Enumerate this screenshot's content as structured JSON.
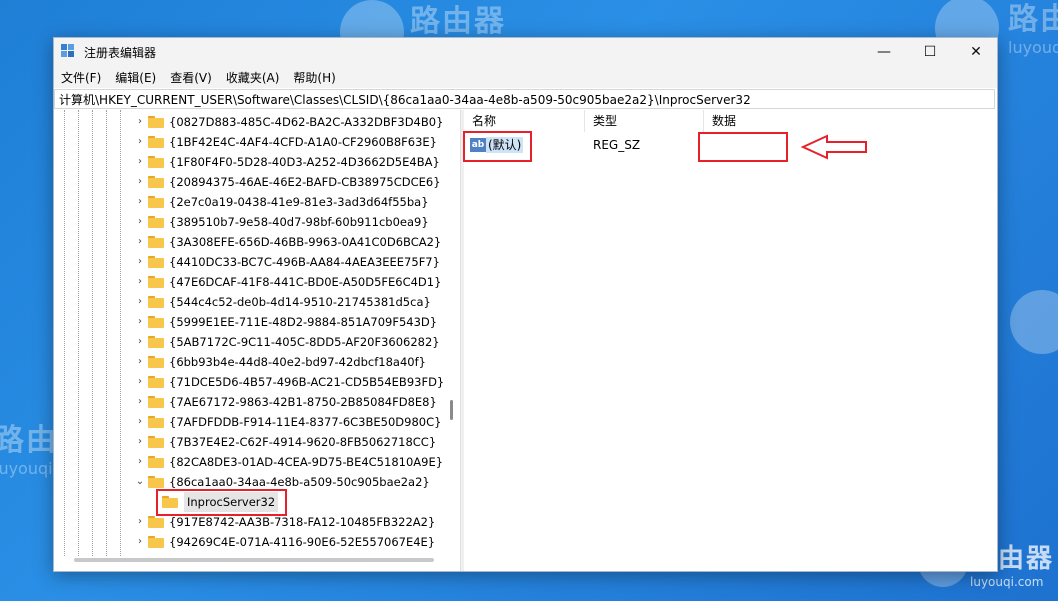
{
  "watermark": {
    "brand": "路由器",
    "site": "luyouqi.com"
  },
  "window": {
    "title": "注册表编辑器",
    "controls": {
      "minimize": "—",
      "maximize": "☐",
      "close": "✕"
    }
  },
  "menu": [
    "文件(F)",
    "编辑(E)",
    "查看(V)",
    "收藏夹(A)",
    "帮助(H)"
  ],
  "address": "计算机\\HKEY_CURRENT_USER\\Software\\Classes\\CLSID\\{86ca1aa0-34aa-4e8b-a509-50c905bae2a2}\\InprocServer32",
  "tree": {
    "items": [
      "{0827D883-485C-4D62-BA2C-A332DBF3D4B0}",
      "{1BF42E4C-4AF4-4CFD-A1A0-CF2960B8F63E}",
      "{1F80F4F0-5D28-40D3-A252-4D3662D5E4BA}",
      "{20894375-46AE-46E2-BAFD-CB38975CDCE6}",
      "{2e7c0a19-0438-41e9-81e3-3ad3d64f55ba}",
      "{389510b7-9e58-40d7-98bf-60b911cb0ea9}",
      "{3A308EFE-656D-46BB-9963-0A41C0D6BCA2}",
      "{4410DC33-BC7C-496B-AA84-4AEA3EEE75F7}",
      "{47E6DCAF-41F8-441C-BD0E-A50D5FE6C4D1}",
      "{544c4c52-de0b-4d14-9510-21745381d5ca}",
      "{5999E1EE-711E-48D2-9884-851A709F543D}",
      "{5AB7172C-9C11-405C-8DD5-AF20F3606282}",
      "{6bb93b4e-44d8-40e2-bd97-42dbcf18a40f}",
      "{71DCE5D6-4B57-496B-AC21-CD5B54EB93FD}",
      "{7AE67172-9863-42B1-8750-2B85084FD8E8}",
      "{7AFDFDDB-F914-11E4-8377-6C3BE50D980C}",
      "{7B37E4E2-C62F-4914-9620-8FB5062718CC}",
      "{82CA8DE3-01AD-4CEA-9D75-BE4C51810A9E}",
      "{86ca1aa0-34aa-4e8b-a509-50c905bae2a2}",
      "{917E8742-AA3B-7318-FA12-10485FB322A2}",
      "{94269C4E-071A-4116-90E6-52E557067E4E}"
    ],
    "expanded_item": "{86ca1aa0-34aa-4e8b-a509-50c905bae2a2}",
    "selected_child": "InprocServer32"
  },
  "list": {
    "columns": [
      "名称",
      "类型",
      "数据"
    ],
    "rows": [
      {
        "icon": "ab",
        "name": "(默认)",
        "type": "REG_SZ",
        "data": ""
      }
    ]
  },
  "colors": {
    "highlight": "#e8202a",
    "folder": "#f7c64a",
    "selection": "#cde3f7"
  }
}
